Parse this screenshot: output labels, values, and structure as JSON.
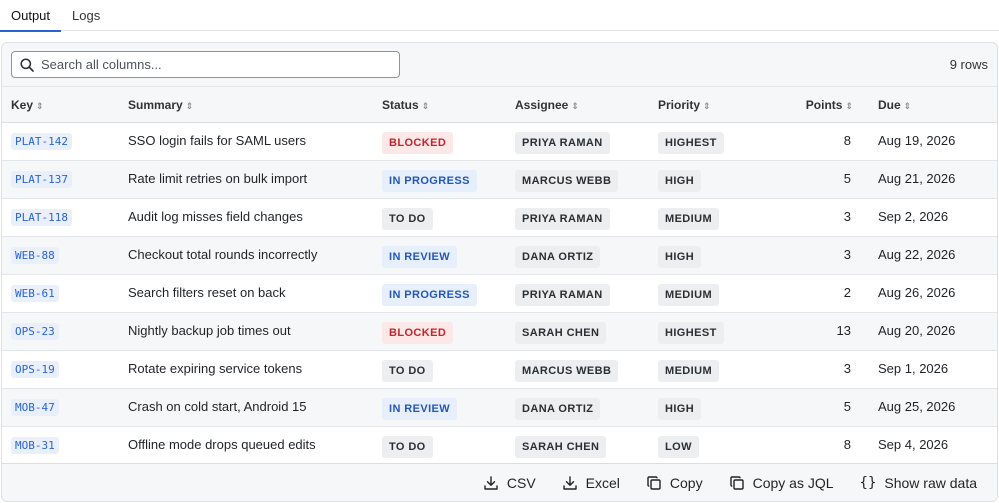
{
  "tabs": [
    {
      "label": "Output",
      "active": true
    },
    {
      "label": "Logs",
      "active": false
    }
  ],
  "search": {
    "placeholder": "Search all columns...",
    "value": ""
  },
  "row_count": "9 rows",
  "columns": [
    "Key",
    "Summary",
    "Status",
    "Assignee",
    "Priority",
    "Points",
    "Due"
  ],
  "rows": [
    {
      "key": "PLAT-142",
      "summary": "SSO login fails for SAML users",
      "status": "BLOCKED",
      "assignee": "PRIYA RAMAN",
      "priority": "HIGHEST",
      "points": "8",
      "due": "Aug 19, 2026"
    },
    {
      "key": "PLAT-137",
      "summary": "Rate limit retries on bulk import",
      "status": "IN PROGRESS",
      "assignee": "MARCUS WEBB",
      "priority": "HIGH",
      "points": "5",
      "due": "Aug 21, 2026"
    },
    {
      "key": "PLAT-118",
      "summary": "Audit log misses field changes",
      "status": "TO DO",
      "assignee": "PRIYA RAMAN",
      "priority": "MEDIUM",
      "points": "3",
      "due": "Sep 2, 2026"
    },
    {
      "key": "WEB-88",
      "summary": "Checkout total rounds incorrectly",
      "status": "IN REVIEW",
      "assignee": "DANA ORTIZ",
      "priority": "HIGH",
      "points": "3",
      "due": "Aug 22, 2026"
    },
    {
      "key": "WEB-61",
      "summary": "Search filters reset on back",
      "status": "IN PROGRESS",
      "assignee": "PRIYA RAMAN",
      "priority": "MEDIUM",
      "points": "2",
      "due": "Aug 26, 2026"
    },
    {
      "key": "OPS-23",
      "summary": "Nightly backup job times out",
      "status": "BLOCKED",
      "assignee": "SARAH CHEN",
      "priority": "HIGHEST",
      "points": "13",
      "due": "Aug 20, 2026"
    },
    {
      "key": "OPS-19",
      "summary": "Rotate expiring service tokens",
      "status": "TO DO",
      "assignee": "MARCUS WEBB",
      "priority": "MEDIUM",
      "points": "3",
      "due": "Sep 1, 2026"
    },
    {
      "key": "MOB-47",
      "summary": "Crash on cold start, Android 15",
      "status": "IN REVIEW",
      "assignee": "DANA ORTIZ",
      "priority": "HIGH",
      "points": "5",
      "due": "Aug 25, 2026"
    },
    {
      "key": "MOB-31",
      "summary": "Offline mode drops queued edits",
      "status": "TO DO",
      "assignee": "SARAH CHEN",
      "priority": "LOW",
      "points": "8",
      "due": "Sep 4, 2026"
    }
  ],
  "footer": {
    "csv": "CSV",
    "excel": "Excel",
    "copy": "Copy",
    "copy_jql": "Copy as JQL",
    "raw": "Show raw data"
  },
  "icons": {
    "search": "search-icon",
    "sort": "sort-icon",
    "download": "download-icon",
    "copy": "copy-icon",
    "braces": "braces-icon"
  },
  "colors": {
    "accent": "#2a63d4",
    "blocked_text": "#c0262d",
    "blocked_bg": "#fde8e8",
    "progress_text": "#2457b7",
    "progress_bg": "#e6effb",
    "neutral_bg": "#eceef0"
  }
}
